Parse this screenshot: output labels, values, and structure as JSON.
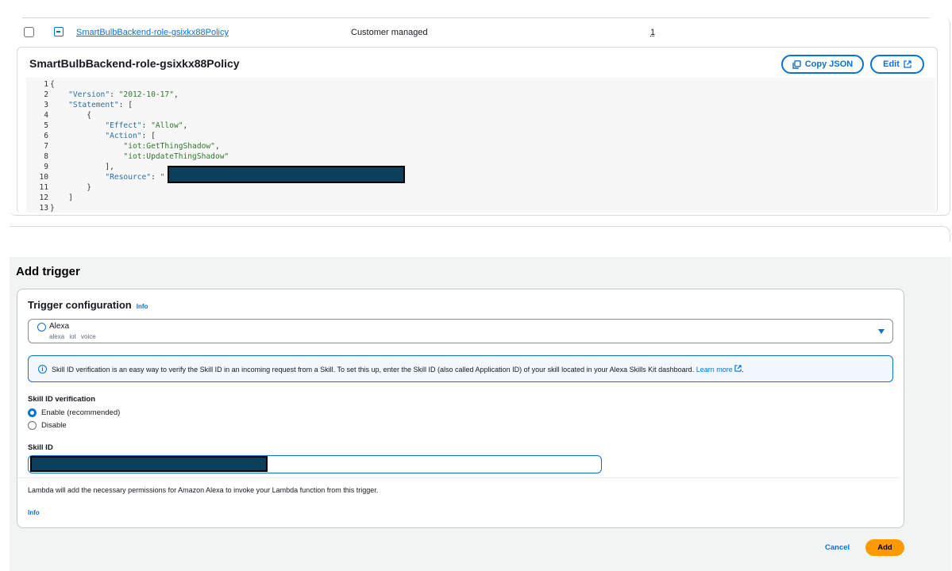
{
  "policy_table": {
    "row": {
      "name": "SmartBulbBackend-role-gsixkx88Policy",
      "type": "Customer managed",
      "count": "1"
    }
  },
  "policy_panel": {
    "title": "SmartBulbBackend-role-gsixkx88Policy",
    "copy_json_label": "Copy JSON",
    "edit_label": "Edit",
    "line_numbers": [
      "1",
      "2",
      "3",
      "4",
      "5",
      "6",
      "7",
      "8",
      "9",
      "10",
      "11",
      "12",
      "13"
    ],
    "code": {
      "version_key": "\"Version\"",
      "version_value": "\"2012-10-17\"",
      "statement_key": "\"Statement\"",
      "effect_key": "\"Effect\"",
      "effect_value": "\"Allow\"",
      "action_key": "\"Action\"",
      "action_1": "\"iot:GetThingShadow\"",
      "action_2": "\"iot:UpdateThingShadow\"",
      "resource_key": "\"Resource\"",
      "resource_open": "\"",
      "resource_tail": "*\""
    }
  },
  "add_trigger": {
    "title": "Add trigger",
    "config_title": "Trigger configuration",
    "info_label": "Info",
    "source": {
      "label": "Alexa",
      "tags": "alexa iot voice"
    },
    "alert": {
      "text": "Skill ID verification is an easy way to verify the Skill ID in an incoming request from a Skill. To set this up, enter the Skill ID (also called Application ID) of your skill located in your Alexa Skills Kit dashboard.",
      "link": "Learn more"
    },
    "verification_label": "Skill ID verification",
    "options": [
      "Enable (recommended)",
      "Disable"
    ],
    "skill_id_label": "Skill ID",
    "permissions_note": "Lambda will add the necessary permissions for Amazon Alexa to invoke your Lambda function from this trigger.",
    "info_footer": "Info",
    "cancel_label": "Cancel",
    "add_label": "Add"
  },
  "colors": {
    "accent": "#0972d3",
    "primary_button": "#ff9900",
    "redaction": "#0c3f5a"
  }
}
